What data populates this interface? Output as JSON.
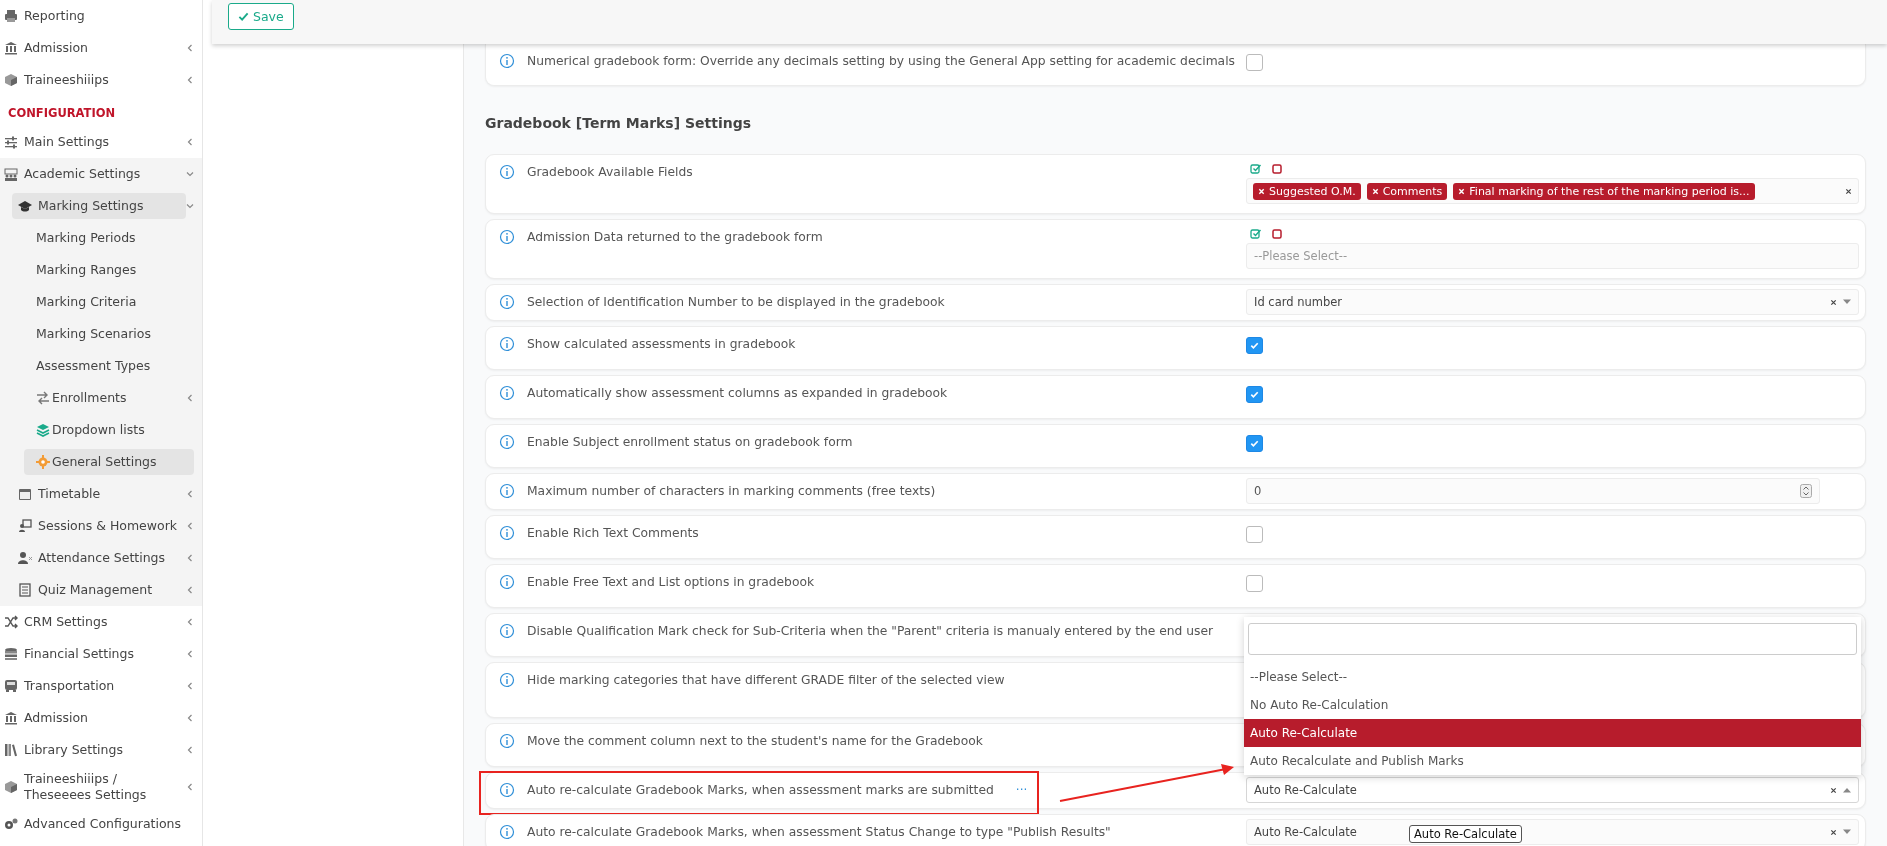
{
  "sidebar": {
    "items": [
      {
        "label": "Reporting",
        "selected": false
      },
      {
        "label": "Admission",
        "selected": false,
        "expanded": false
      },
      {
        "label": "Traineeshiiips",
        "selected": false,
        "expanded": false
      },
      {
        "label": "CONFIGURATION",
        "kind": "section"
      },
      {
        "label": "Main Settings",
        "selected": false,
        "expanded": false
      },
      {
        "label": "Academic Settings",
        "selected": false,
        "expanded": true,
        "children": [
          {
            "label": "Marking Settings",
            "selected": true,
            "expanded": true,
            "children": [
              {
                "label": "Marking Periods",
                "selected": false
              },
              {
                "label": "Marking Ranges",
                "selected": false
              },
              {
                "label": "Marking Criteria",
                "selected": false
              },
              {
                "label": "Marking Scenarios",
                "selected": false
              },
              {
                "label": "Assessment Types",
                "selected": false
              },
              {
                "label": "Enrollments",
                "selected": false,
                "expanded": false
              },
              {
                "label": "Dropdown lists",
                "selected": false
              },
              {
                "label": "General Settings",
                "selected": true
              }
            ]
          },
          {
            "label": "Timetable",
            "selected": false,
            "expanded": false
          },
          {
            "label": "Sessions & Homework",
            "selected": false,
            "expanded": false
          },
          {
            "label": "Attendance Settings",
            "selected": false,
            "expanded": false
          },
          {
            "label": "Quiz Management",
            "selected": false,
            "expanded": false
          }
        ]
      },
      {
        "label": "CRM Settings",
        "selected": false,
        "expanded": false
      },
      {
        "label": "Financial Settings",
        "selected": false,
        "expanded": false
      },
      {
        "label": "Transportation",
        "selected": false,
        "expanded": false
      },
      {
        "label": "Admission",
        "selected": false,
        "expanded": false
      },
      {
        "label": "Library Settings",
        "selected": false,
        "expanded": false
      },
      {
        "label": "Traineeshiiips / Theseeees Settings",
        "selected": false,
        "expanded": false
      },
      {
        "label": "Advanced Configurations",
        "selected": false
      }
    ]
  },
  "toolbar": {
    "save_label": "Save"
  },
  "sections": [
    {
      "rows": [
        {
          "label": "Numerical gradebook form: Override any decimals setting by using the General App setting for academic decimals",
          "kind": "checkbox",
          "checked": false,
          "highlighted": false
        }
      ]
    },
    {
      "heading": "Gradebook [Term Marks] Settings",
      "rows": [
        {
          "label": "Gradebook Available Fields",
          "kind": "tags",
          "highlighted": false,
          "tags": [
            "Suggested O.M.",
            "Comments",
            "Final marking of the rest of the marking period is..."
          ]
        },
        {
          "label": "Admission Data returned to the gradebook form",
          "kind": "multiselect",
          "highlighted": false,
          "placeholder": "--Please Select--"
        },
        {
          "label": "Selection of Identification Number to be displayed in the gradebook",
          "kind": "select",
          "highlighted": false,
          "value": "Id card number",
          "open": false
        },
        {
          "label": "Show calculated assessments in gradebook",
          "kind": "checkbox",
          "checked": true,
          "highlighted": false
        },
        {
          "label": "Automatically show assessment columns as expanded in gradebook",
          "kind": "checkbox",
          "checked": true,
          "highlighted": false
        },
        {
          "label": "Enable Subject enrollment status on gradebook form",
          "kind": "checkbox",
          "checked": true,
          "highlighted": false
        },
        {
          "label": "Maximum number of characters in marking comments (free texts)",
          "kind": "number",
          "highlighted": false,
          "value": "0"
        },
        {
          "label": "Enable Rich Text Comments",
          "kind": "checkbox",
          "checked": false,
          "highlighted": false
        },
        {
          "label": "Enable Free Text and List options in gradebook",
          "kind": "checkbox",
          "checked": false,
          "highlighted": false
        },
        {
          "label": "Disable Qualification Mark check for Sub-Criteria when the \"Parent\" criteria is manualy entered by the end user",
          "kind": "covered",
          "highlighted": false
        },
        {
          "label": "Hide marking categories that have different GRADE filter of the selected view",
          "kind": "covered",
          "highlighted": false
        },
        {
          "label": "Move the comment column next to the student's name for the Gradebook",
          "kind": "covered",
          "highlighted": false
        },
        {
          "label": "Auto re-calculate Gradebook Marks, when assessment marks are submitted",
          "kind": "select",
          "highlighted": true,
          "more": "···",
          "value": "Auto Re-Calculate",
          "open": true,
          "options": [
            {
              "label": "--Please Select--",
              "selected": false
            },
            {
              "label": "No Auto Re-Calculation",
              "selected": false
            },
            {
              "label": "Auto Re-Calculate",
              "selected": true
            },
            {
              "label": "Auto Recalculate and Publish Marks",
              "selected": false
            }
          ]
        },
        {
          "label": "Auto re-calculate Gradebook Marks, when assessment Status Change to type \"Publish Results\"",
          "kind": "select",
          "highlighted": false,
          "value": "Auto Re-Calculate",
          "open": false,
          "tooltip": "Auto Re-Calculate"
        }
      ]
    }
  ]
}
